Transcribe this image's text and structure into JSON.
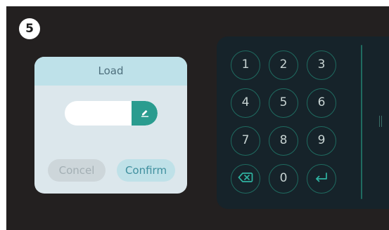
{
  "step_badge": "5",
  "dialog": {
    "title": "Load",
    "input": {
      "value": "",
      "placeholder": ""
    },
    "edit_icon": "pencil-icon",
    "cancel_label": "Concel",
    "confirm_label": "Confirm"
  },
  "keypad": {
    "keys": [
      {
        "label": "1"
      },
      {
        "label": "2"
      },
      {
        "label": "3"
      },
      {
        "label": "4"
      },
      {
        "label": "5"
      },
      {
        "label": "6"
      },
      {
        "label": "7"
      },
      {
        "label": "8"
      },
      {
        "label": "9"
      },
      {
        "icon": "backspace-icon"
      },
      {
        "label": "0"
      },
      {
        "icon": "enter-icon"
      }
    ]
  },
  "colors": {
    "screen_bg": "#232020",
    "keypad_bg": "#16232a",
    "accent": "#2a9c8f",
    "dialog_header": "#bee1e9",
    "dialog_body": "#dce7ec"
  }
}
